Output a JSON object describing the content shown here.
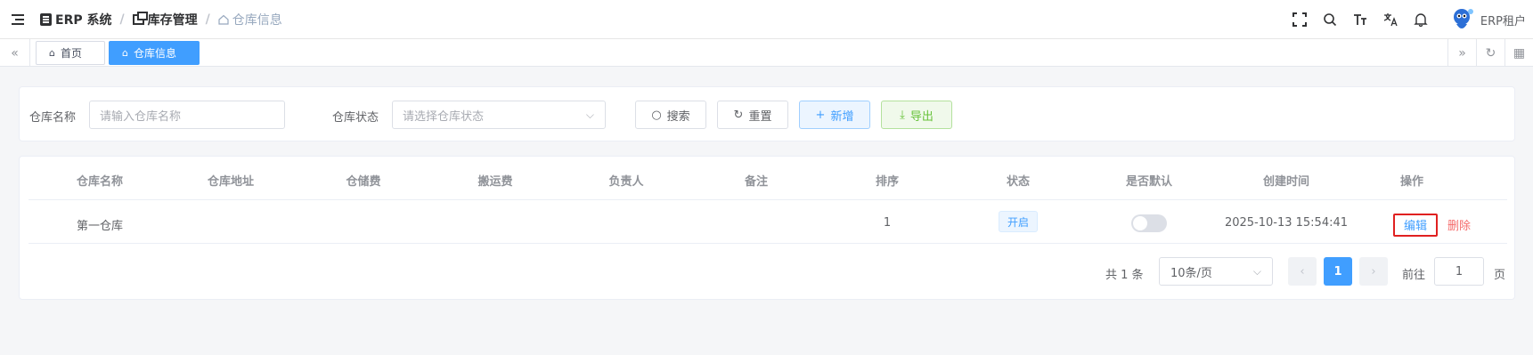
{
  "navbar": {
    "breadcrumb": [
      "ERP 系统",
      "库存管理",
      "仓库信息"
    ],
    "icons": [
      "screen-full-icon",
      "search-icon",
      "font-size-icon",
      "translate-icon",
      "bell-icon"
    ],
    "tenant": "ERP租户"
  },
  "tags": {
    "home": "首页",
    "active": "仓库信息"
  },
  "search": {
    "name_label": "仓库名称",
    "name_placeholder": "请输入仓库名称",
    "status_label": "仓库状态",
    "status_placeholder": "请选择仓库状态",
    "search_btn": "搜索",
    "reset_btn": "重置",
    "add_btn": "新增",
    "export_btn": "导出"
  },
  "table": {
    "headers": [
      "仓库名称",
      "仓库地址",
      "仓储费",
      "搬运费",
      "负责人",
      "备注",
      "排序",
      "状态",
      "是否默认",
      "创建时间",
      "操作"
    ],
    "rows": [
      {
        "name": "第一仓库",
        "address": "",
        "storage_fee": "",
        "handling_fee": "",
        "manager": "",
        "remark": "",
        "sort": "1",
        "status": "开启",
        "is_default": false,
        "created": "2025-10-13 15:54:41",
        "edit": "编辑",
        "delete": "删除"
      }
    ]
  },
  "pagination": {
    "total": "共 1 条",
    "page_size": "10条/页",
    "current": "1",
    "goto_prefix": "前往",
    "goto_value": "1",
    "goto_suffix": "页"
  },
  "colors": {
    "primary": "#409eff",
    "danger": "#f56c6c",
    "success": "#67c23a",
    "highlight": "#e02020"
  }
}
